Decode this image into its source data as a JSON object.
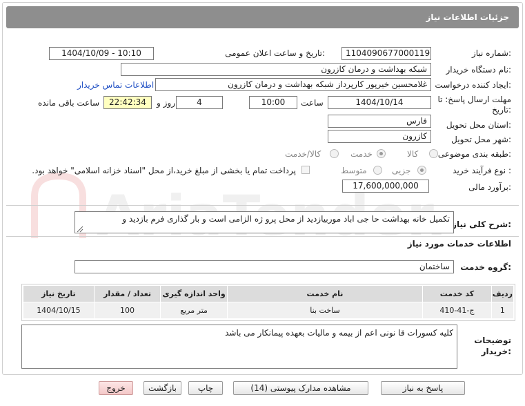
{
  "header": {
    "title": "جزئیات اطلاعات نیاز"
  },
  "form": {
    "need_number": {
      "label": "شماره نیاز:",
      "value": "1104090677000119"
    },
    "announce_datetime": {
      "label": "تاریخ و ساعت اعلان عمومی:",
      "value": "1404/10/09 - 10:10"
    },
    "buyer_org": {
      "label": "نام دستگاه خریدار:",
      "value": "شبکه بهداشت و درمان کازرون"
    },
    "requester": {
      "label": "ایجاد کننده درخواست:",
      "value": "غلامحسین  خیرپور  کارپرداز شبکه بهداشت و درمان کازرون"
    },
    "contact_link": "اطلاعات تماس خریدار",
    "deadline": {
      "label_line1": "مهلت ارسال پاسخ: تا",
      "label_line2": "تاریخ:",
      "date": "1404/10/14",
      "time_label": "ساعت",
      "time": "10:00",
      "days": "4",
      "days_label": "روز و",
      "remaining": "22:42:34",
      "remaining_label": "ساعت باقی مانده"
    },
    "province": {
      "label": "استان محل تحویل:",
      "value": "فارس"
    },
    "city": {
      "label": "شهر محل تحویل:",
      "value": "کازرون"
    },
    "category": {
      "label": "طبقه بندی موضوعی:",
      "options": [
        "کالا",
        "خدمت",
        "کالا/خدمت"
      ],
      "selected": "خدمت"
    },
    "purchase_process": {
      "label": "نوع فرآیند خرید :",
      "options": [
        "جزیی",
        "متوسط"
      ],
      "selected": "جزیی",
      "note": "پرداخت تمام یا بخشی از مبلغ خرید،از محل \"اسناد خزانه اسلامی\" خواهد بود."
    },
    "estimate": {
      "label": "برآورد مالی:",
      "value": "17,600,000,000"
    }
  },
  "description": {
    "label": "شرح کلی نیاز:",
    "value": "تکمیل خانه بهداشت حا جی اباد موربیازدید از محل پرو ژه الزامی است و بار گذاری فرم بازدید و"
  },
  "services": {
    "title": "اطلاعات خدمات مورد نیاز",
    "group_label": "گروه خدمت:",
    "group_value": "ساختمان",
    "columns": [
      "ردیف",
      "کد خدمت",
      "نام خدمت",
      "واحد اندازه گیری",
      "تعداد / مقدار",
      "تاریخ نیاز"
    ],
    "rows": [
      [
        "1",
        "ج-41-410",
        "ساخت بنا",
        "متر مربع",
        "100",
        "1404/10/15"
      ]
    ]
  },
  "notes": {
    "label": "توضیحات خریدار:",
    "value": "کلیه کسورات قا نونی اعم از بیمه و مالیات بعهده پیمانکار می باشد"
  },
  "buttons": {
    "reply": "پاسخ به نیاز",
    "attachments": "مشاهده مدارک پیوستی (14)",
    "print": "چاپ",
    "back": "بازگشت",
    "exit": "خروج"
  },
  "watermark": "AriaTender.net",
  "colors": {
    "header_bg": "#8e8e8e",
    "link": "#1f4fc4",
    "remaining_bg": "#ffffc0"
  }
}
